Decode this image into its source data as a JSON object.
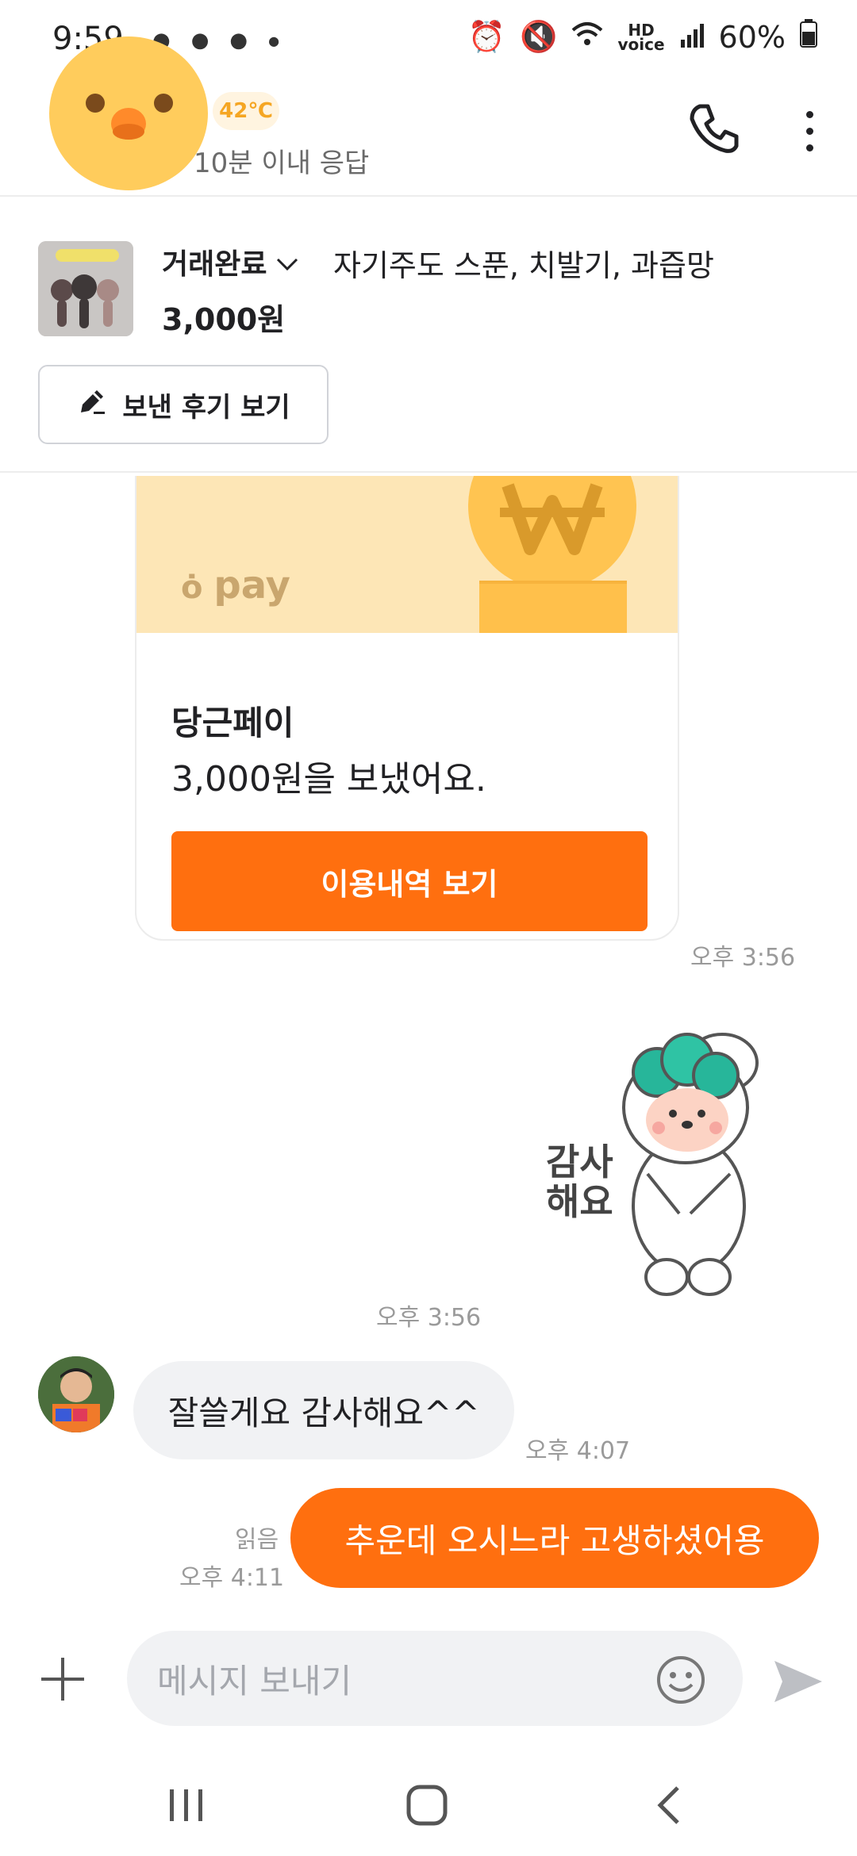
{
  "status_bar": {
    "time": "9:59",
    "battery": "60%"
  },
  "header": {
    "temperature": "42℃",
    "response_time": "10분 이내 응답"
  },
  "product": {
    "status": "거래완료",
    "title": "자기주도 스푼, 치발기, 과즙망",
    "price": "3,000원",
    "review_button": "보낸 후기 보기"
  },
  "pay_card": {
    "logo": "pay",
    "title": "당근페이",
    "subtitle": "3,000원을 보냈어요.",
    "button": "이용내역 보기",
    "time": "오후 3:56"
  },
  "sticker": {
    "text_line1": "감사",
    "text_line2": "해요",
    "time": "오후 3:56"
  },
  "messages": {
    "incoming_text": "잘쓸게요 감사해요^^",
    "incoming_time": "오후 4:07",
    "outgoing_text": "추운데 오시느라 고생하셨어용",
    "outgoing_read": "읽음",
    "outgoing_time": "오후 4:11"
  },
  "input_bar": {
    "placeholder": "메시지 보내기"
  },
  "colors": {
    "accent": "#ff6f0f",
    "bubble_gray": "#f1f2f4"
  }
}
